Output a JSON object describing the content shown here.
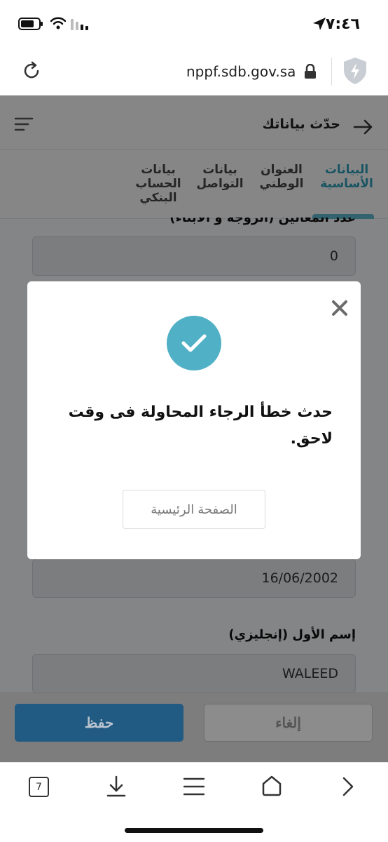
{
  "status_bar": {
    "time": "٧:٤٦"
  },
  "browser": {
    "url": "nppf.sdb.gov.sa",
    "tab_count": "7"
  },
  "header": {
    "title": "حدّث بياناتك"
  },
  "tabs": [
    {
      "label": "البيانات الأساسية",
      "active": true
    },
    {
      "label": "العنوان الوطني",
      "active": false
    },
    {
      "label": "بيانات التواصل",
      "active": false
    },
    {
      "label": "بيانات الحساب البنكي",
      "active": false
    }
  ],
  "form": {
    "cut_label": "عدد المعالين (الزوجة و الأبناء)",
    "dependents_value": "0",
    "birth_date_value": "16/06/2002",
    "first_name_en_label": "إسم الأول (إنجليزي)",
    "first_name_en_value": "WALEED"
  },
  "actions": {
    "save_label": "حفظ",
    "cancel_label": "إلغاء"
  },
  "modal": {
    "message": "حدث خطأ الرجاء المحاولة فى وقت لاحق.",
    "home_button_label": "الصفحة الرئيسية"
  },
  "colors": {
    "accent": "#4fb0c6",
    "primary": "#215a82"
  }
}
